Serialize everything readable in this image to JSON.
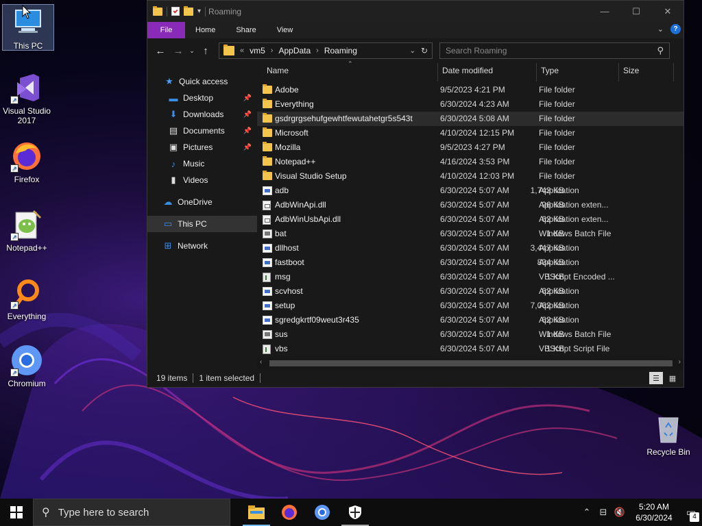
{
  "desktop": {
    "icons": [
      {
        "label": "This PC",
        "icon": "this-pc-icon"
      },
      {
        "label": "Visual Studio 2017",
        "icon": "visual-studio-icon"
      },
      {
        "label": "Firefox",
        "icon": "firefox-icon"
      },
      {
        "label": "Notepad++",
        "icon": "notepadpp-icon"
      },
      {
        "label": "Everything",
        "icon": "everything-icon"
      },
      {
        "label": "Chromium",
        "icon": "chromium-icon"
      },
      {
        "label": "Recycle Bin",
        "icon": "recycle-bin-icon"
      }
    ]
  },
  "explorer": {
    "title": "Roaming",
    "ribbon_tabs": [
      "File",
      "Home",
      "Share",
      "View"
    ],
    "address": {
      "crumb_prefix": "«",
      "crumbs": [
        "vm5",
        "AppData",
        "Roaming"
      ]
    },
    "search": {
      "placeholder": "Search Roaming"
    },
    "nav_pane": [
      {
        "label": "Quick access",
        "icon": "star-icon",
        "pinned": false
      },
      {
        "label": "Desktop",
        "icon": "desktop-icon",
        "pinned": true
      },
      {
        "label": "Downloads",
        "icon": "download-icon",
        "pinned": true
      },
      {
        "label": "Documents",
        "icon": "documents-icon",
        "pinned": true
      },
      {
        "label": "Pictures",
        "icon": "pictures-icon",
        "pinned": true
      },
      {
        "label": "Music",
        "icon": "music-icon",
        "pinned": false
      },
      {
        "label": "Videos",
        "icon": "videos-icon",
        "pinned": false
      },
      {
        "label": "OneDrive",
        "icon": "onedrive-icon",
        "pinned": false
      },
      {
        "label": "This PC",
        "icon": "this-pc-icon",
        "pinned": false,
        "selected": true
      },
      {
        "label": "Network",
        "icon": "network-icon",
        "pinned": false
      }
    ],
    "columns": [
      "Name",
      "Date modified",
      "Type",
      "Size"
    ],
    "files": [
      {
        "name": "Adobe",
        "date": "9/5/2023 4:21 PM",
        "type": "File folder",
        "size": "",
        "kind": "folder"
      },
      {
        "name": "Everything",
        "date": "6/30/2024 4:23 AM",
        "type": "File folder",
        "size": "",
        "kind": "folder"
      },
      {
        "name": "gsdrgrgsehufgewhtfewutahetgr5s543t",
        "date": "6/30/2024 5:08 AM",
        "type": "File folder",
        "size": "",
        "kind": "folder",
        "selected": true
      },
      {
        "name": "Microsoft",
        "date": "4/10/2024 12:15 PM",
        "type": "File folder",
        "size": "",
        "kind": "folder"
      },
      {
        "name": "Mozilla",
        "date": "9/5/2023 4:27 PM",
        "type": "File folder",
        "size": "",
        "kind": "folder"
      },
      {
        "name": "Notepad++",
        "date": "4/16/2024 3:53 PM",
        "type": "File folder",
        "size": "",
        "kind": "folder"
      },
      {
        "name": "Visual Studio Setup",
        "date": "4/10/2024 12:03 PM",
        "type": "File folder",
        "size": "",
        "kind": "folder"
      },
      {
        "name": "adb",
        "date": "6/30/2024 5:07 AM",
        "type": "Application",
        "size": "1,743 KB",
        "kind": "app"
      },
      {
        "name": "AdbWinApi.dll",
        "date": "6/30/2024 5:07 AM",
        "type": "Application exten...",
        "size": "96 KB",
        "kind": "dll"
      },
      {
        "name": "AdbWinUsbApi.dll",
        "date": "6/30/2024 5:07 AM",
        "type": "Application exten...",
        "size": "62 KB",
        "kind": "dll"
      },
      {
        "name": "bat",
        "date": "6/30/2024 5:07 AM",
        "type": "Windows Batch File",
        "size": "1 KB",
        "kind": "bat"
      },
      {
        "name": "dllhost",
        "date": "6/30/2024 5:07 AM",
        "type": "Application",
        "size": "3,447 KB",
        "kind": "app"
      },
      {
        "name": "fastboot",
        "date": "6/30/2024 5:07 AM",
        "type": "Application",
        "size": "834 KB",
        "kind": "app"
      },
      {
        "name": "msg",
        "date": "6/30/2024 5:07 AM",
        "type": "VBScript Encoded ...",
        "size": "1 KB",
        "kind": "vbs"
      },
      {
        "name": "scvhost",
        "date": "6/30/2024 5:07 AM",
        "type": "Application",
        "size": "62 KB",
        "kind": "app"
      },
      {
        "name": "setup",
        "date": "6/30/2024 5:07 AM",
        "type": "Application",
        "size": "7,062 KB",
        "kind": "app"
      },
      {
        "name": "sgredgkrtf09weut3r435",
        "date": "6/30/2024 5:07 AM",
        "type": "Application",
        "size": "62 KB",
        "kind": "app"
      },
      {
        "name": "sus",
        "date": "6/30/2024 5:07 AM",
        "type": "Windows Batch File",
        "size": "1 KB",
        "kind": "bat"
      },
      {
        "name": "vbs",
        "date": "6/30/2024 5:07 AM",
        "type": "VBScript Script File",
        "size": "1 KB",
        "kind": "vbs"
      }
    ],
    "status": {
      "count": "19 items",
      "selection": "1 item selected"
    }
  },
  "taskbar": {
    "search_placeholder": "Type here to search",
    "apps": [
      "file-explorer-icon",
      "firefox-icon",
      "chromium-icon",
      "security-shield-icon"
    ],
    "time": "5:20 AM",
    "date": "6/30/2024",
    "notification_count": "4"
  },
  "colors": {
    "file_tab": "#8a2ab8",
    "folder": "#f3c54d",
    "selection": "#2c2c2c"
  }
}
